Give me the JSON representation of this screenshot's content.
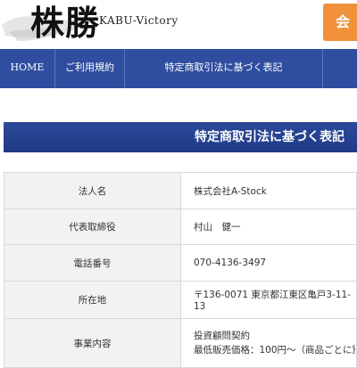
{
  "header": {
    "logo_text": "株勝",
    "logo_sub": "KABU-Victory",
    "cta_label": "会"
  },
  "nav": {
    "items": [
      {
        "label": "HOME"
      },
      {
        "label": "ご利用規約"
      },
      {
        "label": "特定商取引法に基づく表記"
      }
    ]
  },
  "page": {
    "title": "特定商取引法に基づく表記"
  },
  "table": {
    "rows": [
      {
        "label": "法人名",
        "value": "株式会社A-Stock"
      },
      {
        "label": "代表取締役",
        "value": "村山　健一"
      },
      {
        "label": "電話番号",
        "value": "070-4136-3497"
      },
      {
        "label": "所在地",
        "value": "〒136-0071 東京都江東区亀戸3-11-13"
      },
      {
        "label": "事業内容",
        "value_lines": [
          "投資顧問契約",
          "最低販売価格：100円～（商品ごとに別途記載"
        ]
      }
    ]
  },
  "colors": {
    "nav_bg": "#2f4ea0",
    "title_bar_bg": "#1e3a86",
    "cta_bg": "#f0903a",
    "label_bg": "#f2f2f2"
  }
}
